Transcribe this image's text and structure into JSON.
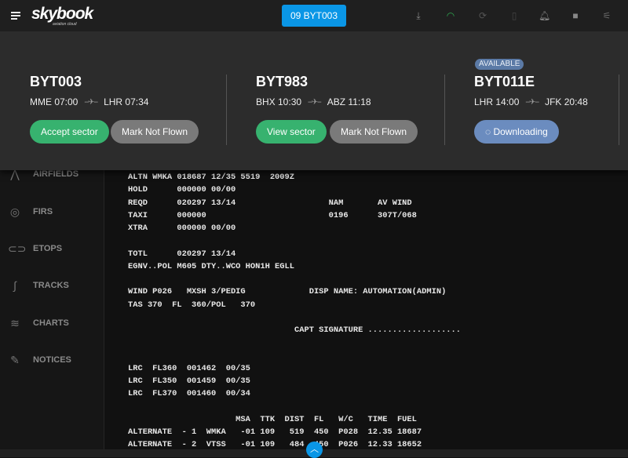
{
  "topbar": {
    "logo": "skybook",
    "logo_sub": "aviation cloud",
    "flight_button": "09 BYT003",
    "icons": [
      {
        "name": "download-icon",
        "glyph": "⤓",
        "color": "#888888"
      },
      {
        "name": "wifi-icon",
        "glyph": "◠",
        "color": "#2fa84f"
      },
      {
        "name": "sync-icon",
        "glyph": "⟳",
        "color": "#555555"
      },
      {
        "name": "bookmark-icon",
        "glyph": "▯",
        "color": "#444444"
      },
      {
        "name": "bell-icon",
        "glyph": "🔔︎",
        "color": "#888888"
      },
      {
        "name": "camera-icon",
        "glyph": "■",
        "color": "#888888"
      },
      {
        "name": "sliders-icon",
        "glyph": "⚟",
        "color": "#666666"
      }
    ]
  },
  "panel": {
    "flights": [
      {
        "id": "BYT003",
        "from": "MME 07:00",
        "to": "LHR 07:34",
        "badge": "",
        "buttons": [
          "Accept sector",
          "Mark Not Flown"
        ]
      },
      {
        "id": "BYT983",
        "from": "BHX 10:30",
        "to": "ABZ 11:18",
        "badge": "",
        "buttons": [
          "View sector",
          "Mark Not Flown"
        ]
      },
      {
        "id": "BYT011E",
        "from": "LHR 14:00",
        "to": "JFK 20:48",
        "badge": "AVAILABLE",
        "buttons": [
          "Downloading"
        ]
      }
    ]
  },
  "sidebar": {
    "items": [
      {
        "label": "AIRFIELDS"
      },
      {
        "label": "FIRS"
      },
      {
        "label": "ETOPS"
      },
      {
        "label": "TRACKS"
      },
      {
        "label": "CHARTS"
      },
      {
        "label": "NOTICES"
      }
    ]
  },
  "document": {
    "lines": [
      "ALTN WMKA 018687 12/35 5519  2009Z",
      "HOLD      000000 00/00",
      "REQD      020297 13/14                   NAM       AV WIND",
      "TAXI      000000                         0196      307T/068",
      "XTRA      000000 00/00",
      "",
      "TOTL      020297 13/14",
      "EGNV..POL M605 DTY..WCO HON1H EGLL",
      "",
      "WIND P026   MXSH 3/PEDIG             DISP NAME: AUTOMATION(ADMIN)",
      "TAS 370  FL  360/POL   370",
      "",
      "                                  CAPT SIGNATURE ...................",
      "",
      "",
      "LRC  FL360  001462  00/35",
      "LRC  FL350  001459  00/35",
      "LRC  FL370  001460  00/34",
      "",
      "                      MSA  TTK  DIST  FL   W/C   TIME  FUEL",
      "ALTERNATE  - 1  WMKA   -01 109   519  450  P028  12.35 18687",
      "ALTERNATE  - 2  VTSS   -01 109   484  450  P026  12.33 18652"
    ]
  }
}
